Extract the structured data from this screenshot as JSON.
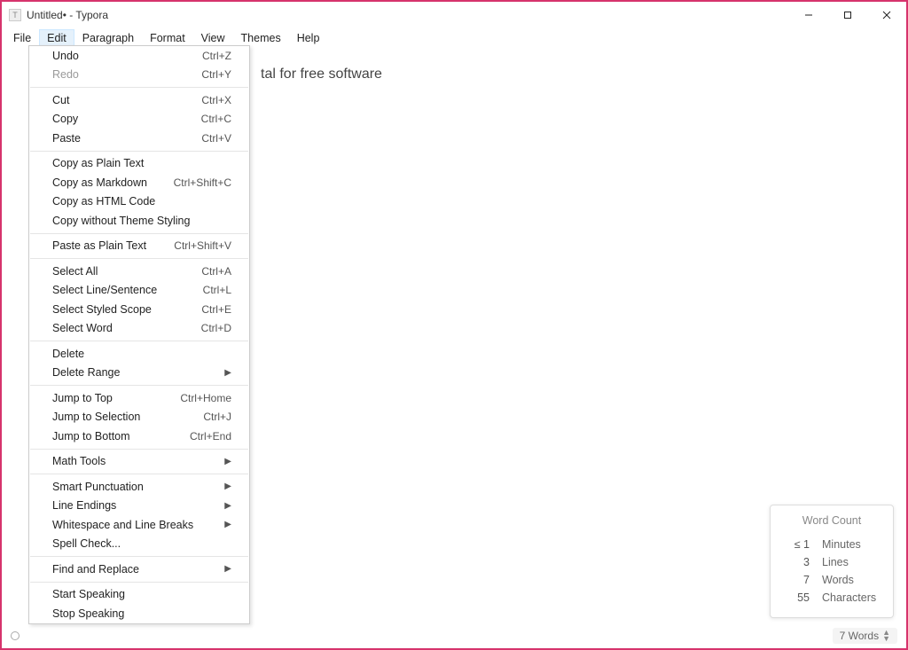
{
  "titlebar": {
    "title": "Untitled• - Typora",
    "app_icon_glyph": "T"
  },
  "menubar": {
    "items": [
      "File",
      "Edit",
      "Paragraph",
      "Format",
      "View",
      "Themes",
      "Help"
    ],
    "active_index": 1
  },
  "document": {
    "visible_text_fragment": "tal for free software"
  },
  "edit_menu": {
    "groups": [
      [
        {
          "label": "Undo",
          "shortcut": "Ctrl+Z",
          "disabled": false,
          "submenu": false
        },
        {
          "label": "Redo",
          "shortcut": "Ctrl+Y",
          "disabled": true,
          "submenu": false
        }
      ],
      [
        {
          "label": "Cut",
          "shortcut": "Ctrl+X",
          "disabled": false,
          "submenu": false
        },
        {
          "label": "Copy",
          "shortcut": "Ctrl+C",
          "disabled": false,
          "submenu": false
        },
        {
          "label": "Paste",
          "shortcut": "Ctrl+V",
          "disabled": false,
          "submenu": false
        }
      ],
      [
        {
          "label": "Copy as Plain Text",
          "shortcut": "",
          "disabled": false,
          "submenu": false
        },
        {
          "label": "Copy as Markdown",
          "shortcut": "Ctrl+Shift+C",
          "disabled": false,
          "submenu": false
        },
        {
          "label": "Copy as HTML Code",
          "shortcut": "",
          "disabled": false,
          "submenu": false
        },
        {
          "label": "Copy without Theme Styling",
          "shortcut": "",
          "disabled": false,
          "submenu": false
        }
      ],
      [
        {
          "label": "Paste as Plain Text",
          "shortcut": "Ctrl+Shift+V",
          "disabled": false,
          "submenu": false
        }
      ],
      [
        {
          "label": "Select All",
          "shortcut": "Ctrl+A",
          "disabled": false,
          "submenu": false
        },
        {
          "label": "Select Line/Sentence",
          "shortcut": "Ctrl+L",
          "disabled": false,
          "submenu": false
        },
        {
          "label": "Select Styled Scope",
          "shortcut": "Ctrl+E",
          "disabled": false,
          "submenu": false
        },
        {
          "label": "Select Word",
          "shortcut": "Ctrl+D",
          "disabled": false,
          "submenu": false
        }
      ],
      [
        {
          "label": "Delete",
          "shortcut": "",
          "disabled": false,
          "submenu": false
        },
        {
          "label": "Delete Range",
          "shortcut": "",
          "disabled": false,
          "submenu": true
        }
      ],
      [
        {
          "label": "Jump to Top",
          "shortcut": "Ctrl+Home",
          "disabled": false,
          "submenu": false
        },
        {
          "label": "Jump to Selection",
          "shortcut": "Ctrl+J",
          "disabled": false,
          "submenu": false
        },
        {
          "label": "Jump to Bottom",
          "shortcut": "Ctrl+End",
          "disabled": false,
          "submenu": false
        }
      ],
      [
        {
          "label": "Math Tools",
          "shortcut": "",
          "disabled": false,
          "submenu": true
        }
      ],
      [
        {
          "label": "Smart Punctuation",
          "shortcut": "",
          "disabled": false,
          "submenu": true
        },
        {
          "label": "Line Endings",
          "shortcut": "",
          "disabled": false,
          "submenu": true
        },
        {
          "label": "Whitespace and Line Breaks",
          "shortcut": "",
          "disabled": false,
          "submenu": true
        },
        {
          "label": "Spell Check...",
          "shortcut": "",
          "disabled": false,
          "submenu": false
        }
      ],
      [
        {
          "label": "Find and Replace",
          "shortcut": "",
          "disabled": false,
          "submenu": true
        }
      ],
      [
        {
          "label": "Start Speaking",
          "shortcut": "",
          "disabled": false,
          "submenu": false
        },
        {
          "label": "Stop Speaking",
          "shortcut": "",
          "disabled": false,
          "submenu": false
        }
      ]
    ]
  },
  "word_count_popup": {
    "title": "Word Count",
    "rows": [
      {
        "value": "≤ 1",
        "label": "Minutes"
      },
      {
        "value": "3",
        "label": "Lines"
      },
      {
        "value": "7",
        "label": "Words"
      },
      {
        "value": "55",
        "label": "Characters"
      }
    ]
  },
  "statusbar": {
    "word_count_label": "7 Words"
  }
}
